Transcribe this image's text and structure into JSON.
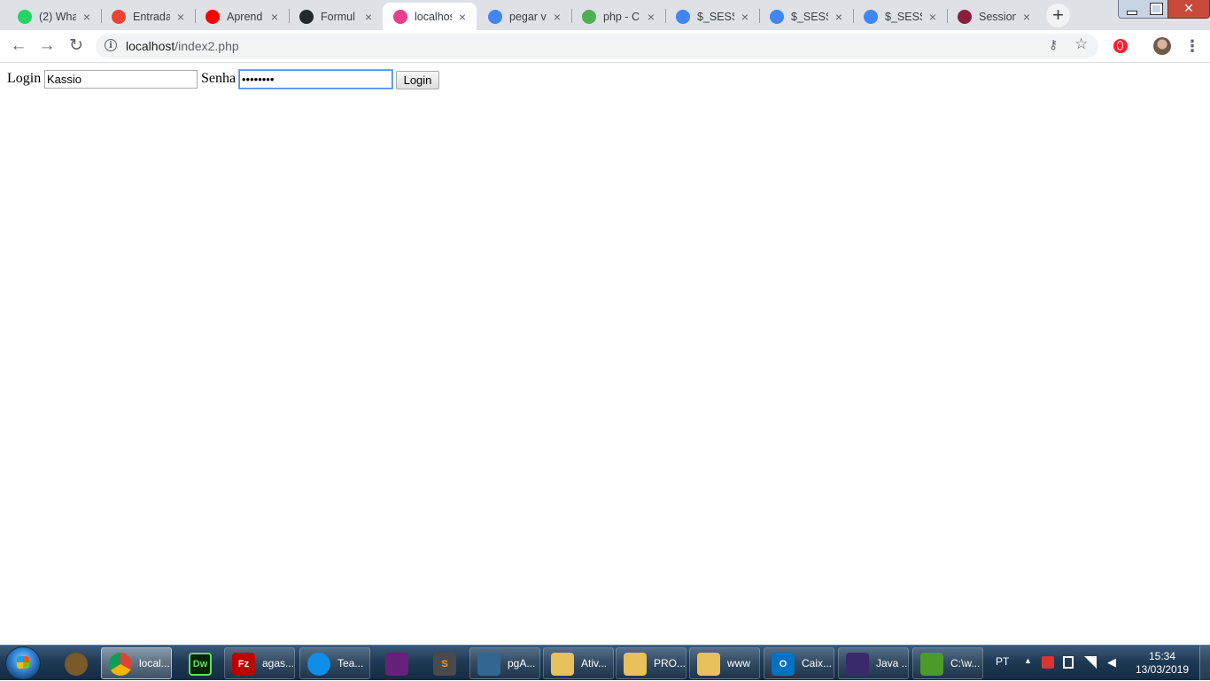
{
  "browser": {
    "tabs": [
      {
        "title": "(2) Wha",
        "icon": "whatsapp-icon",
        "color": "#25d366",
        "active": false
      },
      {
        "title": "Entrada",
        "icon": "gmail-icon",
        "color": "#ea4335",
        "active": false
      },
      {
        "title": "Aprend",
        "icon": "youtube-icon",
        "color": "#ff0000",
        "active": false
      },
      {
        "title": "Formul",
        "icon": "github-icon",
        "color": "#24292e",
        "active": false
      },
      {
        "title": "localhos",
        "icon": "wamp-icon",
        "color": "#e83e8c",
        "active": true
      },
      {
        "title": "pegar v",
        "icon": "google-icon",
        "color": "#4285f4",
        "active": false
      },
      {
        "title": "php - C",
        "icon": "stackoverflow-icon",
        "color": "#4caf50",
        "active": false
      },
      {
        "title": "$_SESS",
        "icon": "google-icon",
        "color": "#4285f4",
        "active": false
      },
      {
        "title": "$_SESS",
        "icon": "google-icon",
        "color": "#4285f4",
        "active": false
      },
      {
        "title": "$_SESS",
        "icon": "google-icon",
        "color": "#4285f4",
        "active": false
      },
      {
        "title": "Session",
        "icon": "w3schools-icon",
        "color": "#8b1e3f",
        "active": false
      }
    ],
    "new_tab_label": "+",
    "address": {
      "host": "localhost",
      "path": "/index2.php"
    }
  },
  "page": {
    "login_label": "Login",
    "login_value": "Kassio",
    "password_label": "Senha",
    "password_value": "••••••••",
    "submit_label": "Login"
  },
  "taskbar": {
    "pinned": [
      {
        "label": "",
        "icon": "media-player-icon",
        "color": "#7a5a2a"
      },
      {
        "label": "local...",
        "icon": "chrome-icon",
        "color": "#4285f4",
        "active": true
      },
      {
        "label": "",
        "icon": "dreamweaver-icon",
        "color": "#072401",
        "text": "Dw"
      },
      {
        "label": "agas...",
        "icon": "filezilla-icon",
        "color": "#bf0000",
        "text": "Fz"
      },
      {
        "label": "Tea...",
        "icon": "teamviewer-icon",
        "color": "#0e8ee9"
      },
      {
        "label": "",
        "icon": "visual-studio-icon",
        "color": "#68217a"
      },
      {
        "label": "",
        "icon": "sublime-text-icon",
        "color": "#4a4a4a",
        "text": "S"
      },
      {
        "label": "pgA...",
        "icon": "pgadmin-icon",
        "color": "#336791"
      },
      {
        "label": "Ativ...",
        "icon": "folder-icon",
        "color": "#e8c15a"
      },
      {
        "label": "PRO...",
        "icon": "folder-icon",
        "color": "#e8c15a"
      },
      {
        "label": "www",
        "icon": "folder-icon",
        "color": "#e8c15a"
      },
      {
        "label": "Caix...",
        "icon": "outlook-icon",
        "color": "#0072c6",
        "text": "O"
      },
      {
        "label": "Java ...",
        "icon": "eclipse-icon",
        "color": "#3b2a6b"
      },
      {
        "label": "C:\\w...",
        "icon": "notepad-icon",
        "color": "#4c9a2a"
      }
    ],
    "tray": {
      "language": "PT",
      "time": "15:34",
      "date": "13/03/2019"
    }
  }
}
